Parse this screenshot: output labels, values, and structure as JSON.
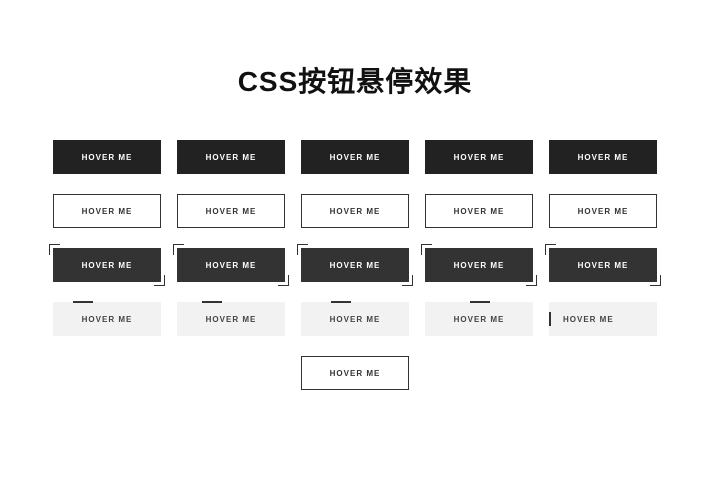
{
  "title": "CSS按钮悬停效果",
  "button_label": "HOVER ME",
  "rows": {
    "row1": [
      "HOVER ME",
      "HOVER ME",
      "HOVER ME",
      "HOVER ME",
      "HOVER ME"
    ],
    "row2": [
      "HOVER ME",
      "HOVER ME",
      "HOVER ME",
      "HOVER ME",
      "HOVER ME"
    ],
    "row3": [
      "HOVER ME",
      "HOVER ME",
      "HOVER ME",
      "HOVER ME",
      "HOVER ME"
    ],
    "row4": [
      "HOVER ME",
      "HOVER ME",
      "HOVER ME",
      "HOVER ME",
      "HOVER ME"
    ],
    "row5": [
      "HOVER ME"
    ]
  }
}
